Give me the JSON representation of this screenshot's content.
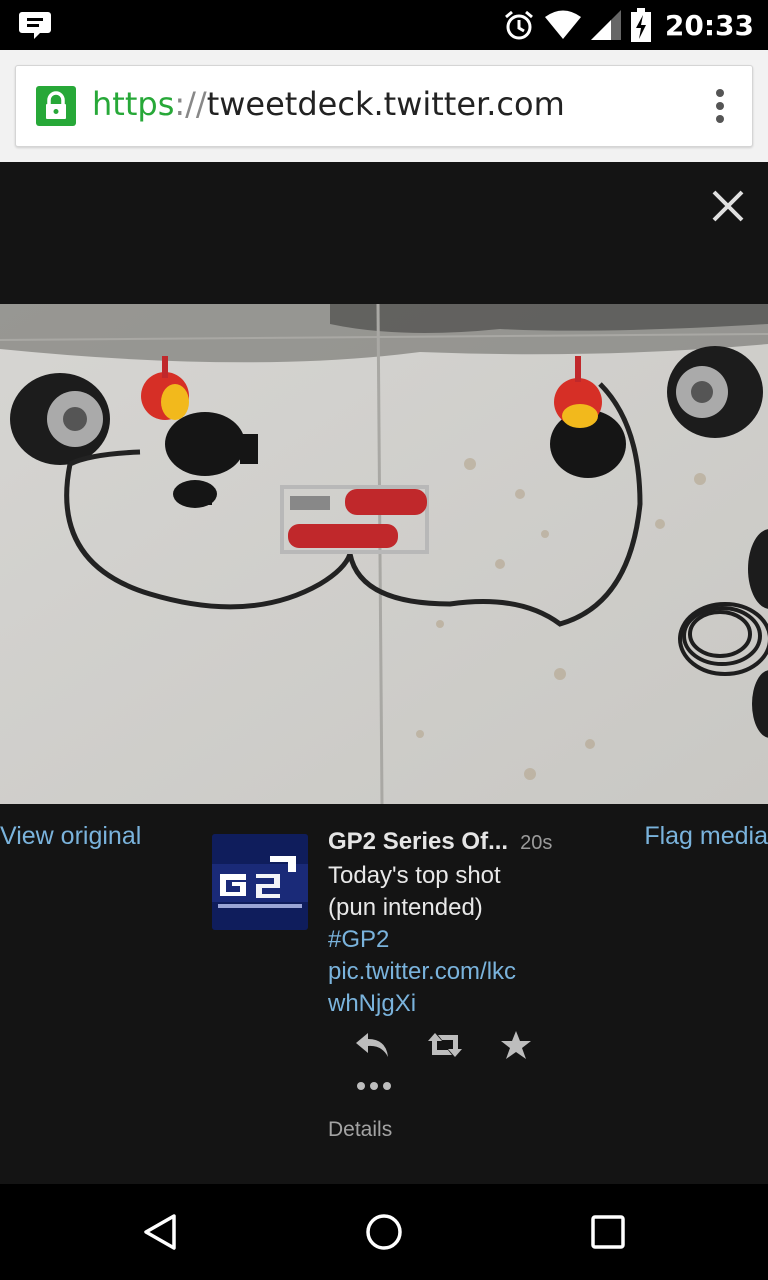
{
  "status_bar": {
    "time": "20:33",
    "icons": [
      "chat-bubble-icon",
      "alarm-icon",
      "wifi-icon",
      "signal-icon",
      "battery-charging-icon"
    ]
  },
  "browser": {
    "url_scheme": "https",
    "url_separator": "://",
    "url_host": "tweetdeck.twitter.com",
    "icons": [
      "lock-icon",
      "overflow-menu-icon"
    ]
  },
  "media_viewer": {
    "close_icon": "close-icon",
    "view_original_label": "View original",
    "flag_media_label": "Flag media"
  },
  "tweet": {
    "author": "GP2 Series Of...",
    "time_ago": "20s",
    "text_line1": "Today's top shot",
    "text_line2": "(pun intended)",
    "hashtag": "#GP2",
    "link_line1": "pic.twitter.com/lkc",
    "link_line2": "whNjgXi",
    "details_label": "Details",
    "action_icons": [
      "reply-icon",
      "retweet-icon",
      "favorite-icon",
      "more-icon"
    ]
  },
  "nav_bar": {
    "icons": [
      "back-icon",
      "home-icon",
      "recents-icon"
    ]
  },
  "colors": {
    "link": "#7ab3dc",
    "secure_green": "#27a838",
    "background": "#141414"
  }
}
